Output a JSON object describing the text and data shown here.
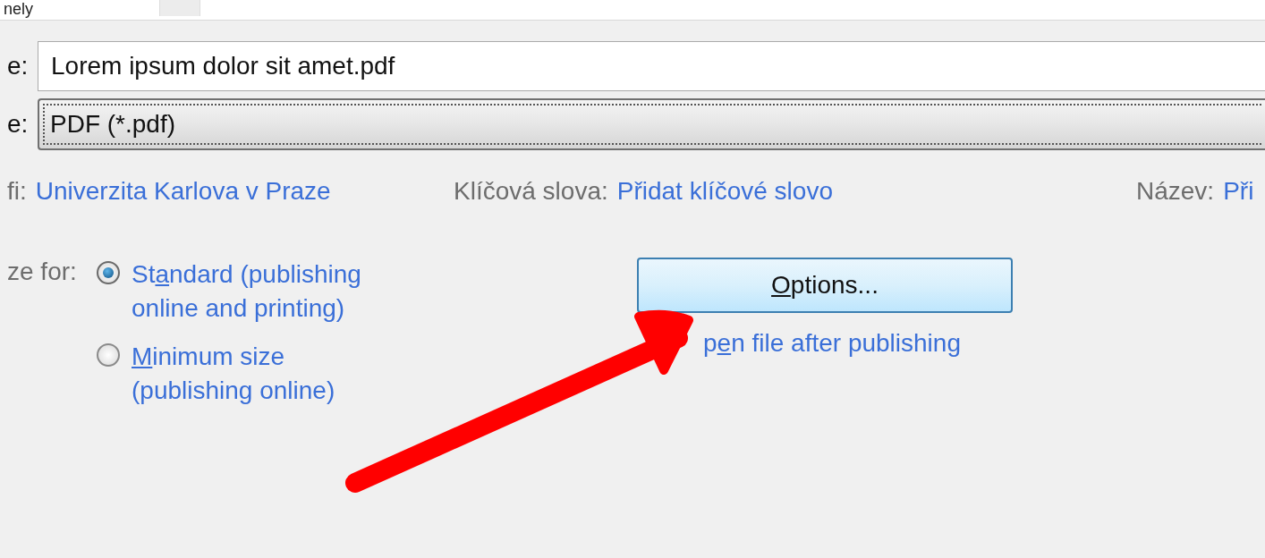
{
  "top_strip": {
    "text": "nely"
  },
  "file_name": {
    "label": "e:",
    "value": "Lorem ipsum dolor sit amet.pdf"
  },
  "file_type": {
    "label": "e:",
    "value": "PDF (*.pdf)"
  },
  "metadata": [
    {
      "label": "fi:",
      "value": "Univerzita Karlova v Praze"
    },
    {
      "label": "Klíčová slova:",
      "value": "Přidat klíčové slovo"
    },
    {
      "label": "Název:",
      "value": "Při"
    }
  ],
  "optimize": {
    "label": "ze for:",
    "options": [
      {
        "before": "St",
        "key": "a",
        "after": "ndard (publishing online and printing)",
        "selected": true
      },
      {
        "key": "M",
        "after": "inimum size (publishing online)",
        "selected": false
      }
    ]
  },
  "options_button": {
    "key": "O",
    "after": "ptions..."
  },
  "open_after": {
    "before": "p",
    "key": "e",
    "after": "n file after publishing"
  }
}
